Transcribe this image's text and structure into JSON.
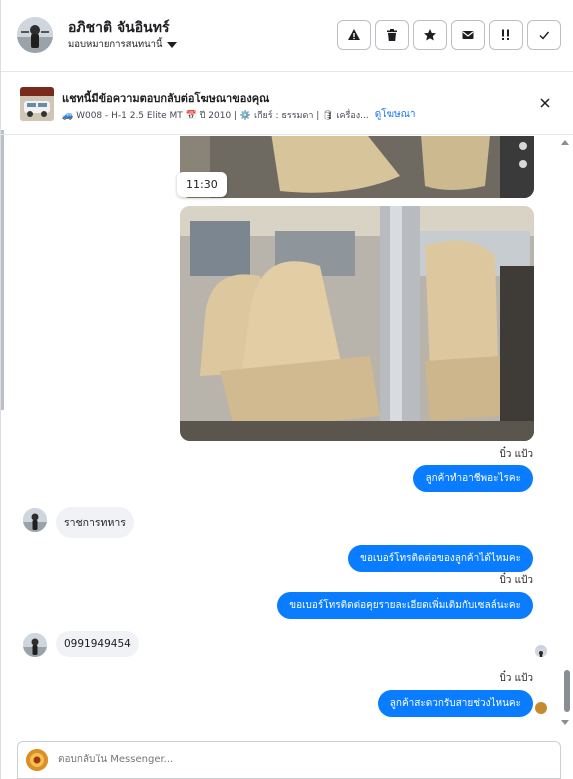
{
  "header": {
    "name": "อภิชาติ จันอินทร์",
    "assign_label": "มอบหมายการสนทนานี้",
    "actions": [
      {
        "icon": "warning-icon"
      },
      {
        "icon": "trash-icon"
      },
      {
        "icon": "star-icon"
      },
      {
        "icon": "envelope-icon"
      },
      {
        "icon": "follow-up-icon"
      },
      {
        "icon": "check-icon"
      }
    ]
  },
  "ad_banner": {
    "title": "แชทนี้มีข้อความตอบกลับต่อโฆษณาของคุณ",
    "description": "🚙 W008 - H-1 2.5 Elite MT 📅 ปี 2010 | ⚙️ เกียร์ : ธรรมดา | 🛢 เครื่อง...",
    "link": "ดูโฆษณา"
  },
  "messages": {
    "time_divider": "11:30",
    "sender_1": "บิ๋ว แป้ว",
    "out_1": "ลูกค้าทำอาชีพอะไรคะ",
    "in_1": "ราชการทหาร",
    "out_2": "ขอเบอร์โทรติดต่อของลูกค้าได้ไหมคะ",
    "sender_2": "บิ๋ว แป้ว",
    "out_3": "ขอเบอร์โทรติดต่อคุยรายละเอียดเพิ่มเติมกับเซลล์นะคะ",
    "in_2": "0991949454",
    "sender_3": "บิ๋ว แป้ว",
    "out_4": "ลูกค้าสะดวกรับสายช่วงไหนคะ"
  },
  "composer": {
    "placeholder": "ตอบกลับใน Messenger..."
  },
  "colors": {
    "outgoing_bubble": "#0a7cff",
    "incoming_bubble": "#f0f2f5",
    "link": "#1877f2"
  }
}
